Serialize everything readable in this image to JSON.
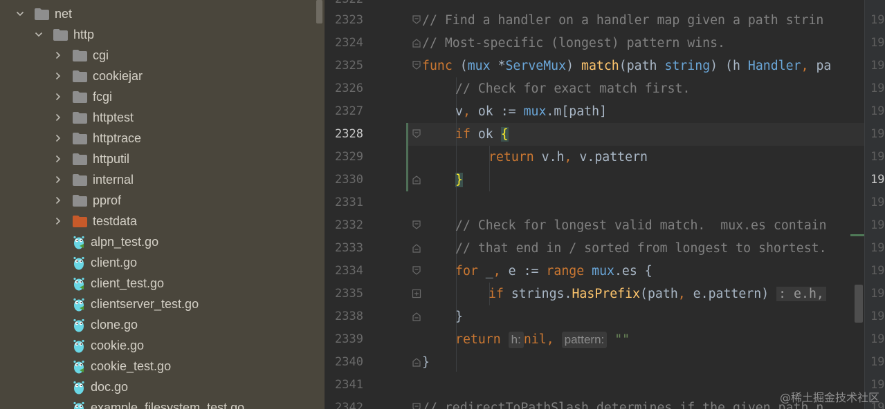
{
  "tree": {
    "items": [
      {
        "label": "net",
        "kind": "folder",
        "expanded": true,
        "level": 0
      },
      {
        "label": "http",
        "kind": "folder",
        "expanded": true,
        "level": 1
      },
      {
        "label": "cgi",
        "kind": "folder",
        "expanded": false,
        "level": 2
      },
      {
        "label": "cookiejar",
        "kind": "folder",
        "expanded": false,
        "level": 2
      },
      {
        "label": "fcgi",
        "kind": "folder",
        "expanded": false,
        "level": 2
      },
      {
        "label": "httptest",
        "kind": "folder",
        "expanded": false,
        "level": 2
      },
      {
        "label": "httptrace",
        "kind": "folder",
        "expanded": false,
        "level": 2
      },
      {
        "label": "httputil",
        "kind": "folder",
        "expanded": false,
        "level": 2
      },
      {
        "label": "internal",
        "kind": "folder",
        "expanded": false,
        "level": 2
      },
      {
        "label": "pprof",
        "kind": "folder",
        "expanded": false,
        "level": 2
      },
      {
        "label": "testdata",
        "kind": "folder-testdata",
        "expanded": false,
        "level": 2
      },
      {
        "label": "alpn_test.go",
        "kind": "go-test",
        "level": 2
      },
      {
        "label": "client.go",
        "kind": "go",
        "level": 2
      },
      {
        "label": "client_test.go",
        "kind": "go-test",
        "level": 2
      },
      {
        "label": "clientserver_test.go",
        "kind": "go-test",
        "level": 2
      },
      {
        "label": "clone.go",
        "kind": "go",
        "level": 2
      },
      {
        "label": "cookie.go",
        "kind": "go",
        "level": 2
      },
      {
        "label": "cookie_test.go",
        "kind": "go-test",
        "level": 2
      },
      {
        "label": "doc.go",
        "kind": "go",
        "level": 2
      },
      {
        "label": "example_filesystem_test.go",
        "kind": "go-test",
        "level": 2
      }
    ]
  },
  "editor": {
    "top_partial_line": "2322",
    "lines": [
      {
        "num": "2323",
        "right": "19"
      },
      {
        "num": "2324",
        "right": "19"
      },
      {
        "num": "2325",
        "right": "19"
      },
      {
        "num": "2326",
        "right": "19"
      },
      {
        "num": "2327",
        "right": "19"
      },
      {
        "num": "2328",
        "right": "19"
      },
      {
        "num": "2329",
        "right": "19"
      },
      {
        "num": "2330",
        "right": "19"
      },
      {
        "num": "2331",
        "right": "19"
      },
      {
        "num": "2332",
        "right": "19"
      },
      {
        "num": "2333",
        "right": "19"
      },
      {
        "num": "2334",
        "right": "19"
      },
      {
        "num": "2335",
        "right": "19"
      },
      {
        "num": "2338",
        "right": "19"
      },
      {
        "num": "2339",
        "right": "19"
      },
      {
        "num": "2340",
        "right": "19"
      },
      {
        "num": "2341",
        "right": "19"
      },
      {
        "num": "2342",
        "right": "19"
      }
    ],
    "current_line": "2328",
    "code": {
      "l2323": {
        "comment": "// Find a handler on a handler map given a path strin"
      },
      "l2324": {
        "comment": "// Most-specific (longest) pattern wins."
      },
      "l2325": {
        "kw_func": "func",
        "p1": " (",
        "recv": "mux",
        "p2": " *",
        "type1": "ServeMux",
        "p3": ") ",
        "fname": "match",
        "p4": "(path ",
        "type2": "string",
        "p5": ") (h ",
        "type3": "Handler",
        "comma": ",",
        "p6": " pa"
      },
      "l2326": {
        "comment": "// Check for exact match first."
      },
      "l2327": {
        "a": "v",
        "comma": ",",
        "b": " ok := ",
        "recv": "mux",
        "c": ".m[path]"
      },
      "l2328": {
        "kw": "if",
        "a": " ok ",
        "brace": "{"
      },
      "l2329": {
        "kw": "return",
        "a": " v.h",
        "comma": ",",
        "b": " v.pattern"
      },
      "l2330": {
        "brace": "}"
      },
      "l2332": {
        "comment": "// Check for longest valid match.  mux.es contain"
      },
      "l2333": {
        "comment": "// that end in / sorted from longest to shortest."
      },
      "l2334": {
        "kw": "for",
        "a": " _",
        "comma": ",",
        "b": " e := ",
        "kw2": "range",
        "c": " ",
        "recv": "mux",
        "d": ".es {"
      },
      "l2335": {
        "kw": "if",
        "a": " strings.",
        "fn": "HasPrefix",
        "b": "(path",
        "comma": ",",
        "c": " e.pattern) ",
        "folded": ": e.h,"
      },
      "l2338": {
        "a": "}"
      },
      "l2339": {
        "kw": "return",
        "hint_h": "h:",
        "kw2": "nil",
        "comma": ",",
        "hint_pattern": "pattern:",
        "str": "\"\""
      },
      "l2340": {
        "a": "}"
      },
      "l2342": {
        "comment": "// redirectToPathSlash determines if the given path n"
      }
    }
  },
  "watermark": "@稀土掘金技术社区",
  "colors": {
    "tree_bg": "#4a463c",
    "editor_bg": "#2b2b2b",
    "keyword": "#cc7832",
    "comment": "#808080",
    "function": "#ffc66d",
    "type": "#6aa6d8",
    "string": "#6a8759",
    "testdata_folder": "#c75a2a",
    "folder": "#8e8e8e"
  }
}
